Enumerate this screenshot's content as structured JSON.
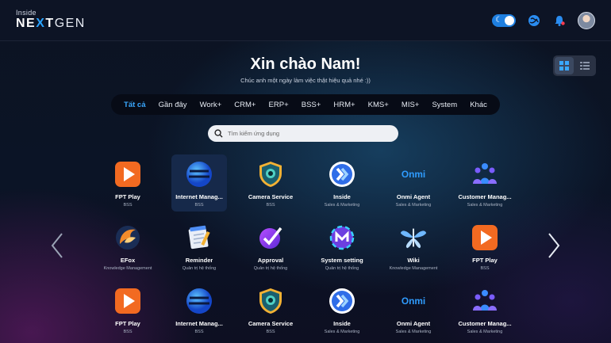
{
  "header": {
    "logo_small": "Inside",
    "logo_next_a": "NE",
    "logo_next_x": "X",
    "logo_next_b": "T",
    "logo_gen": "GEN"
  },
  "greeting": "Xin chào Nam!",
  "subtitle": "Chúc anh một ngày làm việc thật hiệu quả nhé :))",
  "tabs": [
    {
      "label": "Tất cả",
      "active": true
    },
    {
      "label": "Gần đây"
    },
    {
      "label": "Work+"
    },
    {
      "label": "CRM+"
    },
    {
      "label": "ERP+"
    },
    {
      "label": "BSS+"
    },
    {
      "label": "HRM+"
    },
    {
      "label": "KMS+"
    },
    {
      "label": "MIS+"
    },
    {
      "label": "System"
    },
    {
      "label": "Khác"
    }
  ],
  "search": {
    "placeholder": "Tìm kiếm ứng dụng"
  },
  "apps": [
    {
      "name": "FPT Play",
      "category": "BSS",
      "icon": "fpt-play-icon"
    },
    {
      "name": "Internet Manag...",
      "category": "BSS",
      "icon": "internet-manager-icon",
      "selected": true
    },
    {
      "name": "Camera Service",
      "category": "BSS",
      "icon": "camera-service-icon"
    },
    {
      "name": "Inside",
      "category": "Sales & Marketing",
      "icon": "inside-icon"
    },
    {
      "name": "Onmi Agent",
      "category": "Sales & Marketing",
      "icon": "onmi-agent-icon"
    },
    {
      "name": "Customer Manag...",
      "category": "Sales & Marketing",
      "icon": "customer-management-icon"
    },
    {
      "name": "EFox",
      "category": "Knowledge Management",
      "icon": "efox-icon"
    },
    {
      "name": "Reminder",
      "category": "Quản trị hệ thống",
      "icon": "reminder-icon"
    },
    {
      "name": "Approval",
      "category": "Quản trị hệ thống",
      "icon": "approval-icon"
    },
    {
      "name": "System setting",
      "category": "Quản trị hệ thống",
      "icon": "system-setting-icon"
    },
    {
      "name": "Wiki",
      "category": "Knowledge Management",
      "icon": "wiki-icon"
    },
    {
      "name": "FPT Play",
      "category": "BSS",
      "icon": "fpt-play-icon"
    },
    {
      "name": "FPT Play",
      "category": "BSS",
      "icon": "fpt-play-icon"
    },
    {
      "name": "Internet Manag...",
      "category": "BSS",
      "icon": "internet-manager-icon"
    },
    {
      "name": "Camera Service",
      "category": "BSS",
      "icon": "camera-service-icon"
    },
    {
      "name": "Inside",
      "category": "Sales & Marketing",
      "icon": "inside-icon"
    },
    {
      "name": "Onmi Agent",
      "category": "Sales & Marketing",
      "icon": "onmi-agent-icon"
    },
    {
      "name": "Customer Manag...",
      "category": "Sales & Marketing",
      "icon": "customer-management-icon"
    }
  ],
  "onmi_logo_text": "Onmi",
  "colors": {
    "accent": "#3aa8ff",
    "toggle": "#1e7fe0",
    "tab_bar": "#070b16"
  }
}
